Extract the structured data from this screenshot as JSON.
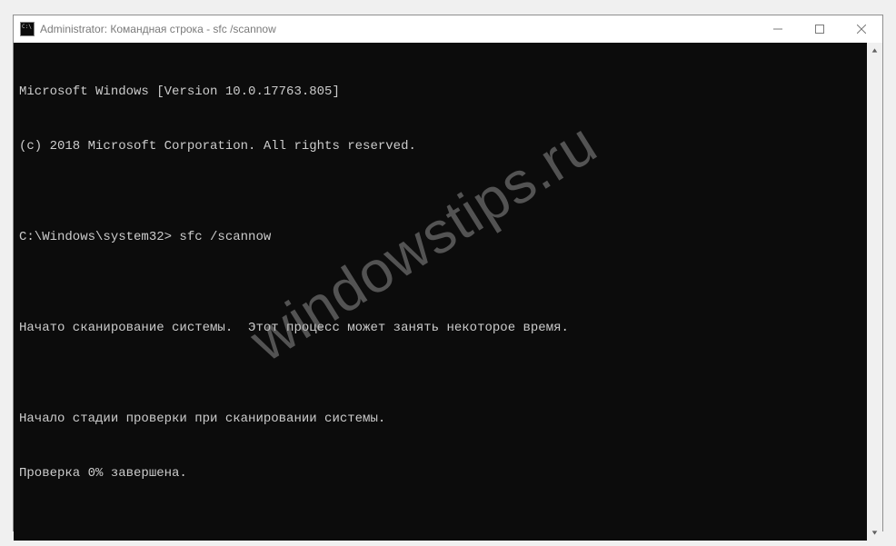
{
  "titlebar": {
    "title": "Administrator: Командная строка - sfc  /scannow"
  },
  "terminal": {
    "lines": [
      "Microsoft Windows [Version 10.0.17763.805]",
      "(c) 2018 Microsoft Corporation. All rights reserved.",
      "",
      "C:\\Windows\\system32> sfc /scannow",
      "",
      "Начато сканирование системы.  Этот процесс может занять некоторое время.",
      "",
      "Начало стадии проверки при сканировании системы.",
      "Проверка 0% завершена."
    ]
  },
  "watermark": {
    "text": "windowstips.ru"
  }
}
